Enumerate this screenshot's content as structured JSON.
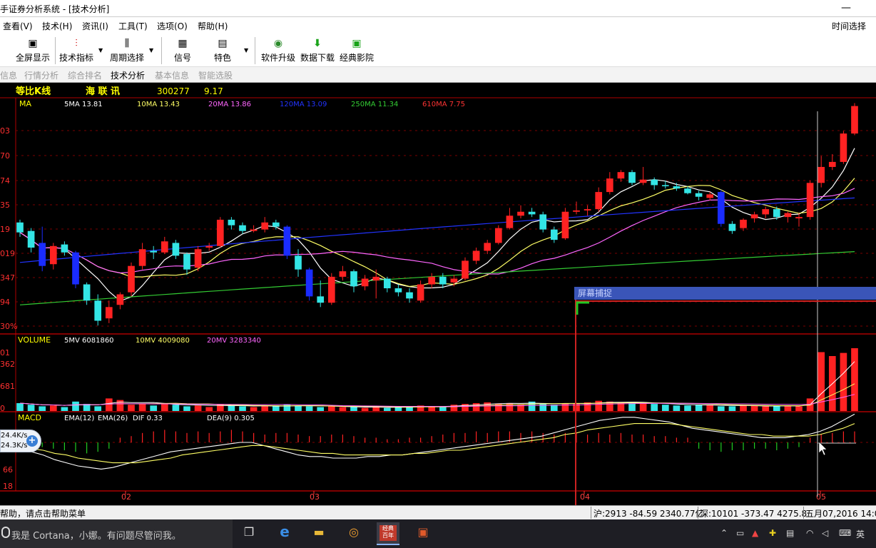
{
  "window": {
    "title": "手证券分析系统 - [技术分析]",
    "minimize": "—"
  },
  "menu": {
    "items": [
      "查看(V)",
      "技术(H)",
      "资讯(I)",
      "工具(T)",
      "选项(O)",
      "帮助(H)"
    ],
    "right": "时间选择"
  },
  "toolbar": {
    "buttons": [
      {
        "label": "全屏显示",
        "icon": "fullscreen-icon"
      },
      {
        "label": "技术指标",
        "icon": "indicator-icon"
      },
      {
        "label": "周期选择",
        "icon": "period-icon"
      },
      {
        "label": "信号",
        "icon": "signal-icon"
      },
      {
        "label": "特色",
        "icon": "feature-icon"
      },
      {
        "label": "软件升级",
        "icon": "upgrade-icon"
      },
      {
        "label": "数据下载",
        "icon": "download-icon"
      },
      {
        "label": "经典影院",
        "icon": "cinema-icon"
      }
    ]
  },
  "tabs": [
    {
      "label": "信息",
      "active": false
    },
    {
      "label": "行情分析",
      "active": false
    },
    {
      "label": "综合排名",
      "active": false
    },
    {
      "label": "技术分析",
      "active": true
    },
    {
      "label": "基本信息",
      "active": false
    },
    {
      "label": "智能选股",
      "active": false
    }
  ],
  "stock": {
    "chart_mode": "等比K线",
    "name": "海 联 讯",
    "code": "300277",
    "price": "9.17"
  },
  "ma_panel": {
    "label": "MA",
    "legend": [
      {
        "text": "5MA 13.81",
        "color": "#ffffff"
      },
      {
        "text": "10MA 13.43",
        "color": "#ffff66"
      },
      {
        "text": "20MA 13.86",
        "color": "#ff66ff"
      },
      {
        "text": "120MA 13.09",
        "color": "#2233ff"
      },
      {
        "text": "250MA 11.34",
        "color": "#33cc33"
      },
      {
        "text": "610MA 7.75",
        "color": "#ff3333"
      }
    ],
    "y_ticks": [
      "03",
      "70",
      "74",
      "35",
      "19",
      "019",
      "347",
      "94",
      "30%"
    ]
  },
  "volume_panel": {
    "label": "VOLUME",
    "legend": [
      {
        "text": "5MV 6081860",
        "color": "#ffffff"
      },
      {
        "text": "10MV 4009080",
        "color": "#ffff66"
      },
      {
        "text": "20MV 3283340",
        "color": "#ff66ff"
      }
    ],
    "y_ticks": [
      "01",
      "362",
      "681",
      "0"
    ]
  },
  "macd_panel": {
    "label": "MACD",
    "legend": [
      {
        "text": "EMA(12)",
        "color": "#ffffff"
      },
      {
        "text": "EMA(26)",
        "color": "#ffffff"
      },
      {
        "text": "DIF 0.33",
        "color": "#ffffff"
      },
      {
        "text": "DEA(9) 0.305",
        "color": "#ffffff"
      }
    ],
    "y_ticks": [
      "66",
      "18"
    ]
  },
  "x_axis": {
    "labels": [
      "02",
      "03",
      "04",
      "05"
    ]
  },
  "overlay": {
    "capture_title": "屏幕捕捉"
  },
  "net_speed": {
    "up": "24.4K/s",
    "down": "24.3K/s",
    "plus": "+"
  },
  "colors": {
    "up": "#ff2222",
    "down": "#33e5e5",
    "down_blue": "#1a2cff",
    "grid": "#aa0000",
    "axis": "#ff3030"
  },
  "status": {
    "help": "帮助，请点击帮助菜单",
    "sh": "沪:2913 -84.59 2340.77亿",
    "sz": "深:10101 -373.47 4275.8",
    "date": "五月07,2016 14:0"
  },
  "taskbar": {
    "cortana": "我是 Cortana，小娜。有问题尽管问我。",
    "ime": "英",
    "app_label": "经典\n百年"
  },
  "chart_data": {
    "type": "candlestick",
    "title": "等比K线",
    "series_name": "海 联 讯 300277",
    "x_month_labels": [
      "02",
      "03",
      "04",
      "05"
    ],
    "candles": [
      {
        "o": 13.2,
        "c": 12.5,
        "h": 13.4,
        "l": 12.2
      },
      {
        "o": 12.6,
        "c": 11.5,
        "h": 12.8,
        "l": 11.2
      },
      {
        "o": 11.8,
        "c": 10.4,
        "h": 12.9,
        "l": 10.1
      },
      {
        "o": 10.5,
        "c": 11.6,
        "h": 11.8,
        "l": 10.2
      },
      {
        "o": 11.7,
        "c": 11.2,
        "h": 11.9,
        "l": 11.0
      },
      {
        "o": 11.2,
        "c": 9.4,
        "h": 11.3,
        "l": 9.2
      },
      {
        "o": 9.4,
        "c": 8.6,
        "h": 9.5,
        "l": 8.4
      },
      {
        "o": 8.6,
        "c": 7.7,
        "h": 8.9,
        "l": 7.5
      },
      {
        "o": 7.8,
        "c": 8.3,
        "h": 8.6,
        "l": 7.6
      },
      {
        "o": 8.4,
        "c": 8.9,
        "h": 9.0,
        "l": 8.2
      },
      {
        "o": 9.0,
        "c": 10.4,
        "h": 10.6,
        "l": 8.8
      },
      {
        "o": 10.4,
        "c": 11.4,
        "h": 11.8,
        "l": 10.2
      },
      {
        "o": 11.3,
        "c": 11.2,
        "h": 11.6,
        "l": 10.8
      },
      {
        "o": 11.2,
        "c": 11.9,
        "h": 12.2,
        "l": 11.1
      },
      {
        "o": 11.8,
        "c": 11.0,
        "h": 12.0,
        "l": 10.8
      },
      {
        "o": 11.1,
        "c": 10.2,
        "h": 11.2,
        "l": 9.9
      },
      {
        "o": 10.3,
        "c": 11.4,
        "h": 11.6,
        "l": 10.1
      },
      {
        "o": 11.5,
        "c": 11.6,
        "h": 11.8,
        "l": 11.3
      },
      {
        "o": 11.6,
        "c": 13.4,
        "h": 13.6,
        "l": 11.5
      },
      {
        "o": 13.4,
        "c": 13.0,
        "h": 13.6,
        "l": 12.7
      },
      {
        "o": 13.0,
        "c": 12.6,
        "h": 13.2,
        "l": 12.4
      },
      {
        "o": 12.6,
        "c": 12.7,
        "h": 13.0,
        "l": 12.5
      },
      {
        "o": 12.7,
        "c": 13.2,
        "h": 13.6,
        "l": 12.5
      },
      {
        "o": 13.2,
        "c": 12.9,
        "h": 13.4,
        "l": 12.7
      },
      {
        "o": 12.9,
        "c": 11.0,
        "h": 13.0,
        "l": 10.8
      },
      {
        "o": 11.0,
        "c": 10.2,
        "h": 11.4,
        "l": 9.8
      },
      {
        "o": 10.2,
        "c": 8.8,
        "h": 10.3,
        "l": 8.6
      },
      {
        "o": 8.8,
        "c": 8.5,
        "h": 9.6,
        "l": 8.3
      },
      {
        "o": 8.5,
        "c": 9.8,
        "h": 10.0,
        "l": 8.4
      },
      {
        "o": 9.8,
        "c": 10.1,
        "h": 10.4,
        "l": 9.6
      },
      {
        "o": 10.1,
        "c": 9.3,
        "h": 10.2,
        "l": 9.0
      },
      {
        "o": 9.3,
        "c": 9.7,
        "h": 9.9,
        "l": 9.1
      },
      {
        "o": 9.6,
        "c": 9.8,
        "h": 10.2,
        "l": 8.7
      },
      {
        "o": 9.7,
        "c": 9.2,
        "h": 9.8,
        "l": 9.0
      },
      {
        "o": 9.2,
        "c": 9.0,
        "h": 9.4,
        "l": 8.8
      },
      {
        "o": 9.0,
        "c": 8.7,
        "h": 9.2,
        "l": 8.5
      },
      {
        "o": 8.6,
        "c": 9.4,
        "h": 9.6,
        "l": 8.5
      },
      {
        "o": 9.4,
        "c": 9.8,
        "h": 10.0,
        "l": 9.2
      },
      {
        "o": 9.8,
        "c": 9.4,
        "h": 10.0,
        "l": 9.2
      },
      {
        "o": 9.5,
        "c": 9.7,
        "h": 9.9,
        "l": 9.3
      },
      {
        "o": 9.7,
        "c": 10.7,
        "h": 10.9,
        "l": 9.6
      },
      {
        "o": 10.7,
        "c": 11.3,
        "h": 11.5,
        "l": 10.5
      },
      {
        "o": 11.3,
        "c": 11.8,
        "h": 12.0,
        "l": 11.1
      },
      {
        "o": 11.8,
        "c": 12.8,
        "h": 13.0,
        "l": 11.7
      },
      {
        "o": 12.8,
        "c": 13.7,
        "h": 14.3,
        "l": 12.7
      },
      {
        "o": 13.7,
        "c": 14.0,
        "h": 14.5,
        "l": 13.5
      },
      {
        "o": 14.0,
        "c": 13.8,
        "h": 14.3,
        "l": 13.6
      },
      {
        "o": 13.8,
        "c": 12.7,
        "h": 14.0,
        "l": 12.5
      },
      {
        "o": 12.7,
        "c": 12.0,
        "h": 12.9,
        "l": 11.8
      },
      {
        "o": 12.1,
        "c": 14.0,
        "h": 14.3,
        "l": 12.0
      },
      {
        "o": 14.0,
        "c": 14.1,
        "h": 14.8,
        "l": 13.8
      },
      {
        "o": 14.1,
        "c": 14.2,
        "h": 14.5,
        "l": 13.7
      },
      {
        "o": 14.2,
        "c": 15.6,
        "h": 16.0,
        "l": 14.0
      },
      {
        "o": 15.6,
        "c": 16.8,
        "h": 17.4,
        "l": 15.4
      },
      {
        "o": 16.8,
        "c": 17.4,
        "h": 17.6,
        "l": 16.5
      },
      {
        "o": 17.4,
        "c": 16.4,
        "h": 17.6,
        "l": 16.2
      },
      {
        "o": 16.4,
        "c": 16.7,
        "h": 17.9,
        "l": 16.2
      },
      {
        "o": 16.7,
        "c": 16.2,
        "h": 16.9,
        "l": 15.8
      },
      {
        "o": 16.2,
        "c": 16.1,
        "h": 16.6,
        "l": 15.9
      },
      {
        "o": 16.1,
        "c": 15.9,
        "h": 16.4,
        "l": 15.7
      },
      {
        "o": 15.9,
        "c": 15.5,
        "h": 16.1,
        "l": 15.4
      },
      {
        "o": 15.5,
        "c": 15.2,
        "h": 15.7,
        "l": 14.9
      },
      {
        "o": 15.1,
        "c": 15.4,
        "h": 15.6,
        "l": 14.9
      },
      {
        "o": 15.6,
        "c": 13.1,
        "h": 15.8,
        "l": 12.9
      },
      {
        "o": 13.1,
        "c": 12.6,
        "h": 13.3,
        "l": 12.4
      },
      {
        "o": 12.8,
        "c": 13.4,
        "h": 13.5,
        "l": 12.6
      },
      {
        "o": 13.5,
        "c": 13.8,
        "h": 14.0,
        "l": 13.2
      },
      {
        "o": 13.8,
        "c": 14.2,
        "h": 14.4,
        "l": 13.5
      },
      {
        "o": 14.2,
        "c": 13.6,
        "h": 14.4,
        "l": 13.4
      },
      {
        "o": 13.6,
        "c": 13.9,
        "h": 14.0,
        "l": 13.2
      },
      {
        "o": 13.5,
        "c": 13.6,
        "h": 13.9,
        "l": 12.9
      },
      {
        "o": 13.6,
        "c": 16.4,
        "h": 16.6,
        "l": 13.4
      },
      {
        "o": 16.4,
        "c": 17.9,
        "h": 19.0,
        "l": 16.0
      },
      {
        "o": 17.9,
        "c": 18.4,
        "h": 19.2,
        "l": 17.6
      },
      {
        "o": 18.4,
        "c": 21.5,
        "h": 21.8,
        "l": 18.2
      },
      {
        "o": 21.5,
        "c": 25.0,
        "h": 25.4,
        "l": 21.3
      }
    ],
    "volume": [
      1,
      0.8,
      0.6,
      0.7,
      0.5,
      1.2,
      0.9,
      0.6,
      1.6,
      1.4,
      0.8,
      0.9,
      0.7,
      1.0,
      0.8,
      0.6,
      0.7,
      0.5,
      0.9,
      0.7,
      0.6,
      0.5,
      0.6,
      0.7,
      0.8,
      0.7,
      0.6,
      0.5,
      0.6,
      0.5,
      0.5,
      0.4,
      0.5,
      0.4,
      0.6,
      0.5,
      0.7,
      0.6,
      0.5,
      0.8,
      0.9,
      1.0,
      1.1,
      0.9,
      1.0,
      0.8,
      1.2,
      0.9,
      0.8,
      1.0,
      0.9,
      1.1,
      1.3,
      1.2,
      1.1,
      1.0,
      1.0,
      0.9,
      0.8,
      0.7,
      0.7,
      0.8,
      0.8,
      0.6,
      0.6,
      0.7,
      0.7,
      0.6,
      0.6,
      0.7,
      0.6,
      1.6,
      7.5,
      7.0,
      7.4,
      8.0
    ],
    "macd_hist": [
      0.6,
      0.5,
      -0.3,
      -0.4,
      -0.5,
      -0.6,
      -0.7,
      -0.6,
      -0.4,
      0.3,
      0.4,
      0.6,
      0.7,
      0.8,
      0.7,
      0.6,
      0.7,
      0.6,
      0.7,
      0.8,
      0.7,
      0.6,
      0.5,
      0.6,
      0.6,
      0.5,
      0.4,
      0.4,
      0.5,
      0.5,
      0.4,
      0.3,
      0.3,
      0.2,
      0.2,
      0.3,
      0.3,
      0.4,
      0.5,
      0.6,
      0.6,
      0.7,
      0.6,
      0.7,
      0.7,
      0.6,
      0.7,
      0.6,
      0.5,
      0.6,
      0.6,
      0.5,
      0.6,
      0.5,
      0.6,
      0.5,
      0.5,
      0.4,
      0.4,
      0.3,
      0.3,
      -0.4,
      -0.5,
      -0.6,
      -0.5,
      -0.5,
      -0.4,
      -0.4,
      -0.5,
      -0.4,
      -0.3,
      0.3,
      0.5,
      0.6,
      0.7,
      0.7
    ],
    "dif": [
      -0.4,
      -0.6,
      -0.8,
      -1.1,
      -1.3,
      -1.5,
      -1.6,
      -1.7,
      -1.6,
      -1.4,
      -1.2,
      -1.0,
      -0.8,
      -0.6,
      -0.5,
      -0.4,
      -0.3,
      -0.2,
      -0.1,
      0.0,
      0.0,
      -0.2,
      -0.4,
      -0.6,
      -0.8,
      -0.9,
      -0.9,
      -1.0,
      -1.0,
      -1.0,
      -0.9,
      -0.9,
      -0.8,
      -0.8,
      -0.7,
      -0.6,
      -0.5,
      -0.4,
      -0.3,
      -0.2,
      -0.1,
      0.0,
      0.1,
      0.2,
      0.3,
      0.4,
      0.6,
      0.8,
      1.0,
      1.2,
      1.4,
      1.5,
      1.6,
      1.6,
      1.5,
      1.4,
      1.3,
      1.1,
      0.9,
      0.8,
      0.7,
      0.6,
      0.5,
      0.4,
      0.3,
      0.3,
      0.3,
      0.4,
      0.5,
      0.7,
      1.0,
      1.4,
      1.8
    ],
    "dea": [
      -0.3,
      -0.4,
      -0.5,
      -0.7,
      -0.8,
      -1.0,
      -1.1,
      -1.2,
      -1.3,
      -1.3,
      -1.3,
      -1.2,
      -1.1,
      -1.0,
      -0.8,
      -0.7,
      -0.6,
      -0.5,
      -0.4,
      -0.3,
      -0.2,
      -0.2,
      -0.3,
      -0.4,
      -0.5,
      -0.6,
      -0.7,
      -0.7,
      -0.8,
      -0.8,
      -0.8,
      -0.8,
      -0.8,
      -0.8,
      -0.7,
      -0.7,
      -0.6,
      -0.5,
      -0.5,
      -0.4,
      -0.3,
      -0.2,
      -0.1,
      0.0,
      0.1,
      0.2,
      0.3,
      0.5,
      0.6,
      0.8,
      0.9,
      1.0,
      1.1,
      1.2,
      1.2,
      1.2,
      1.2,
      1.1,
      1.0,
      0.9,
      0.8,
      0.7,
      0.6,
      0.5,
      0.5,
      0.4,
      0.4,
      0.4,
      0.4,
      0.5,
      0.7,
      0.9,
      1.2
    ]
  }
}
